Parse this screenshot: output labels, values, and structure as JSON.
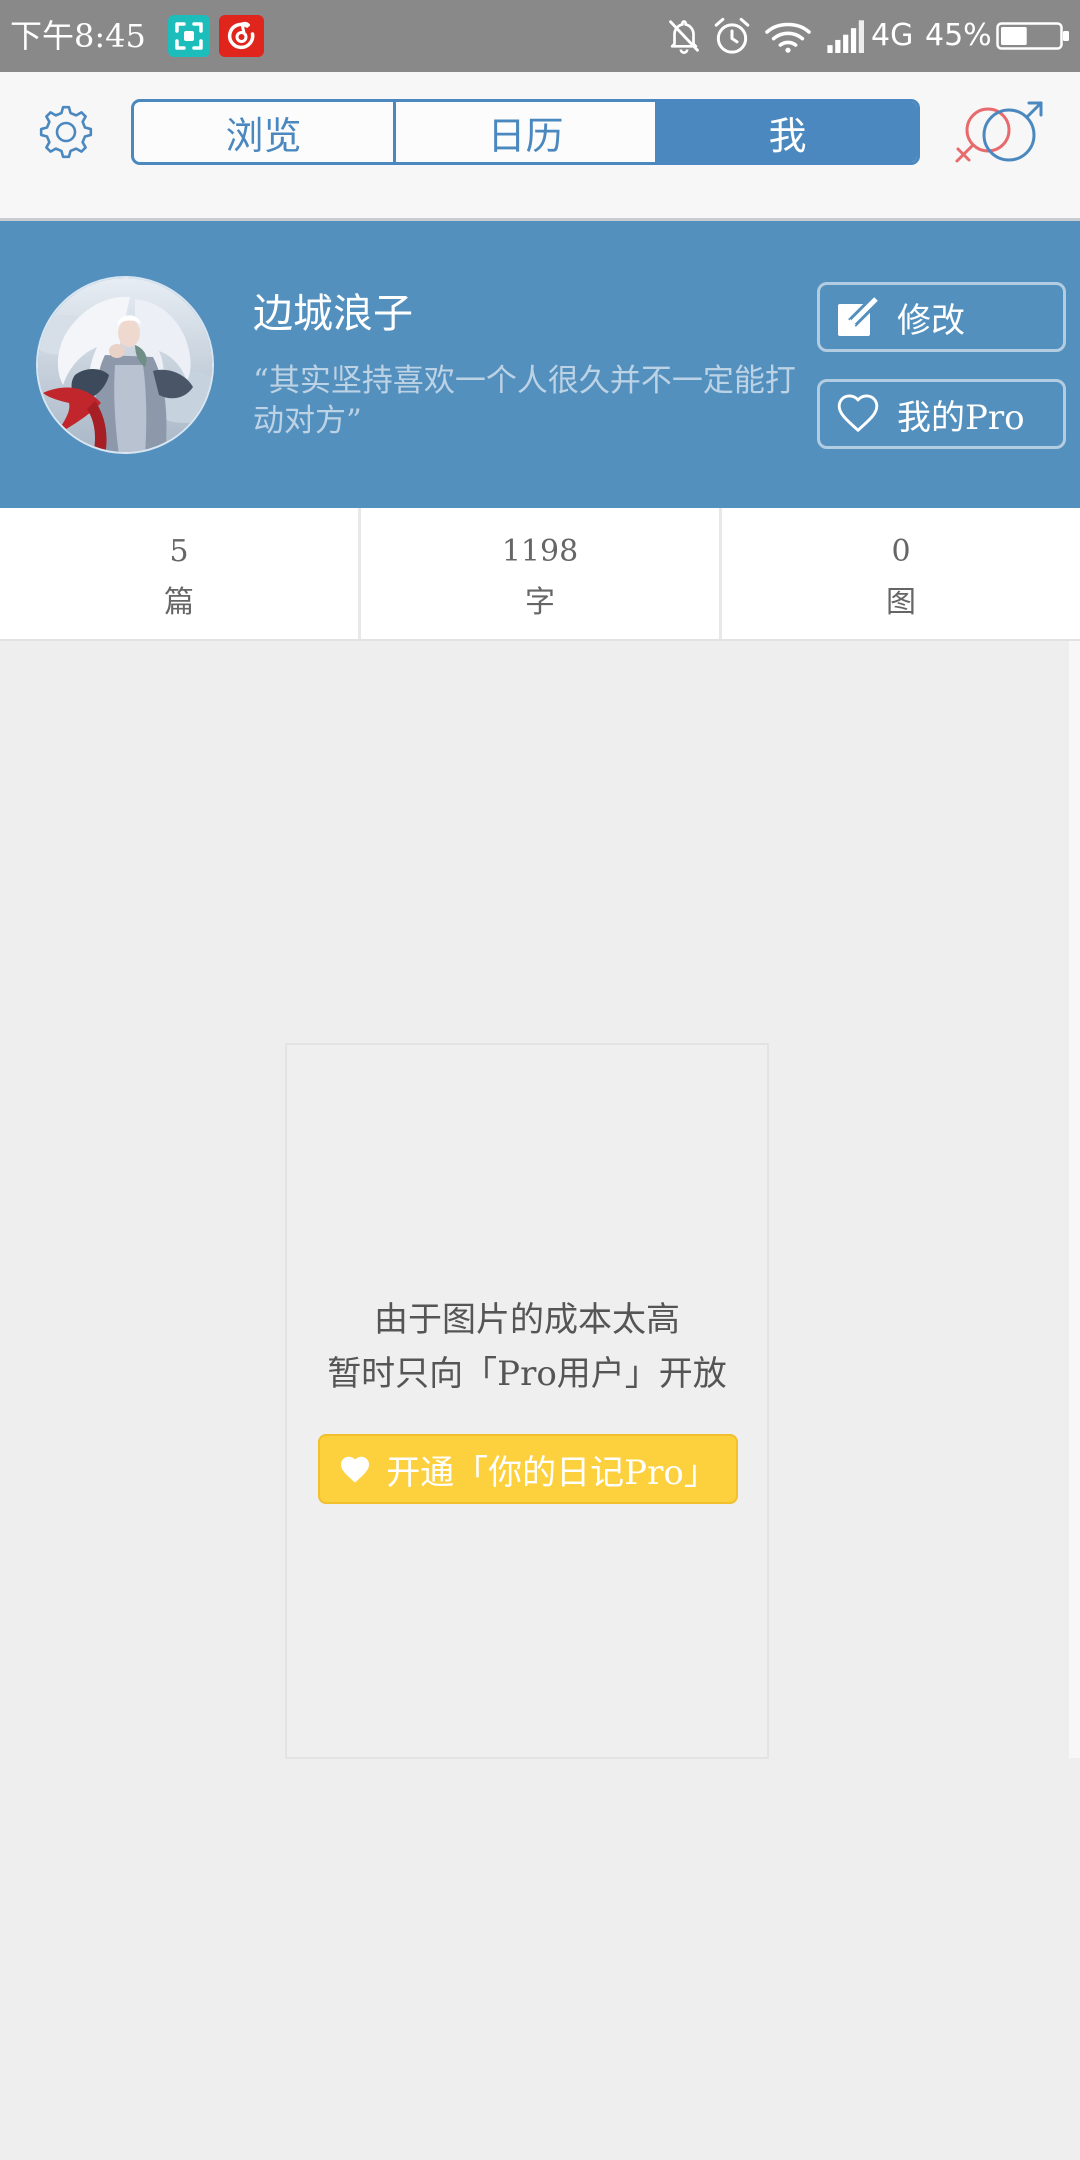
{
  "status_bar": {
    "time": "下午8:45",
    "network": "4G",
    "battery_percent": "45%",
    "battery_level": 0.45,
    "app_icons": [
      "screen-capture-app-icon",
      "netease-music-app-icon"
    ],
    "system_icons": [
      "notifications-muted-icon",
      "alarm-icon",
      "wifi-icon",
      "cellular-signal-icon",
      "battery-icon"
    ]
  },
  "header": {
    "settings_icon": "gear-icon",
    "gender_icon": "gender-symbol-icon",
    "tabs": [
      {
        "label": "浏览",
        "selected": false
      },
      {
        "label": "日历",
        "selected": false
      },
      {
        "label": "我",
        "selected": true
      }
    ]
  },
  "profile": {
    "name": "边城浪子",
    "bio": "“其实坚持喜欢一个人很久并不一定能打动对方”",
    "edit_label": "修改",
    "edit_icon": "edit-icon",
    "pro_label": "我的Pro",
    "pro_icon": "heart-outline-icon"
  },
  "stats": [
    {
      "value": "5",
      "label": "篇"
    },
    {
      "value": "1198",
      "label": "字"
    },
    {
      "value": "0",
      "label": "图"
    }
  ],
  "image_notice": {
    "line1": "由于图片的成本太高",
    "line2": "暂时只向「Pro用户」开放",
    "button_label": "开通「你的日记Pro」",
    "button_icon": "heart-filled-icon"
  },
  "colors": {
    "accent": "#4a88bf",
    "profile_background": "#5490be",
    "upgrade_button": "#fdd03d",
    "status_bar": "#898989",
    "page_background": "#eeeeee",
    "female_symbol": "#e86a6c"
  }
}
